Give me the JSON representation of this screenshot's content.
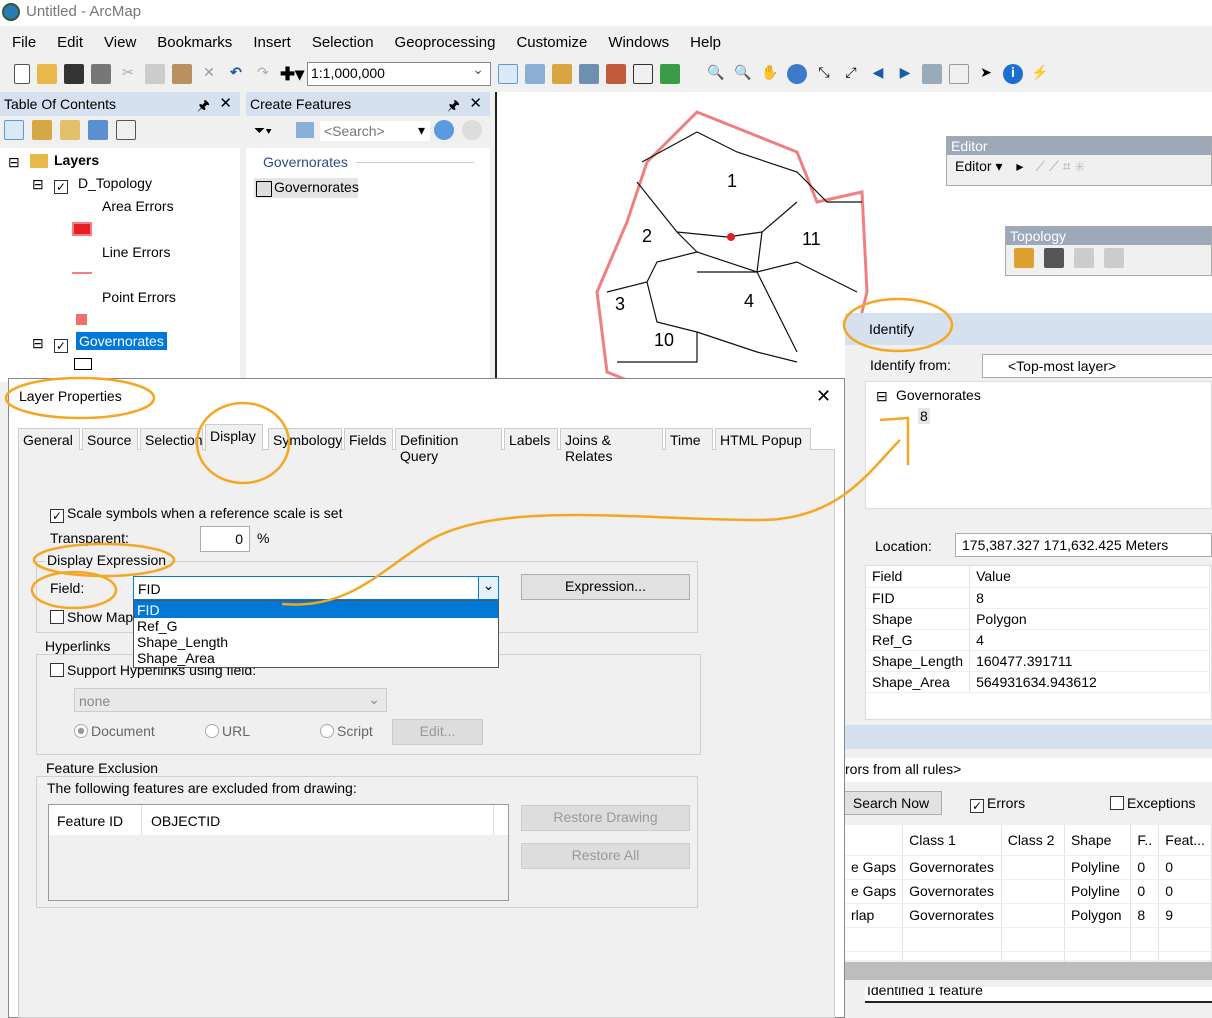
{
  "app": {
    "title": "Untitled - ArcMap"
  },
  "menu": [
    "File",
    "Edit",
    "View",
    "Bookmarks",
    "Insert",
    "Selection",
    "Geoprocessing",
    "Customize",
    "Windows",
    "Help"
  ],
  "toolbar": {
    "scale": "1:1,000,000"
  },
  "toc": {
    "title": "Table Of Contents",
    "layers_root": "Layers",
    "topology": "D_Topology",
    "area_errors": "Area Errors",
    "line_errors": "Line Errors",
    "point_errors": "Point Errors",
    "governorates": "Governorates"
  },
  "create_features": {
    "title": "Create Features",
    "search_placeholder": "<Search>",
    "group": "Governorates",
    "item": "Governorates"
  },
  "map": {
    "labels": [
      "1",
      "2",
      "11",
      "3",
      "4",
      "10"
    ],
    "error_color": "#f08080"
  },
  "editor": {
    "title": "Editor",
    "menu": "Editor ▾"
  },
  "topology": {
    "title": "Topology"
  },
  "identify": {
    "title": "Identify",
    "from_label": "Identify from:",
    "from_value": "<Top-most layer>",
    "tree_layer": "Governorates",
    "tree_item": "8",
    "location_label": "Location:",
    "location_value": "175,387.327  171,632.425 Meters",
    "headers": [
      "Field",
      "Value"
    ],
    "rows": [
      [
        "FID",
        "8"
      ],
      [
        "Shape",
        "Polygon"
      ],
      [
        "Ref_G",
        "4"
      ],
      [
        "Shape_Length",
        "160477.391711"
      ],
      [
        "Shape_Area",
        "564931634.943612"
      ]
    ],
    "status": "Identified 1 feature"
  },
  "error_inspector": {
    "show": "rors from all rules>",
    "search_now": "Search Now",
    "errors_label": "Errors",
    "errors_checked": true,
    "exceptions_label": "Exceptions",
    "exceptions_checked": false,
    "headers": [
      "",
      "Class 1",
      "Class 2",
      "Shape",
      "F..",
      "Feat..."
    ],
    "rows": [
      [
        "e Gaps",
        "Governorates",
        "",
        "Polyline",
        "0",
        "0"
      ],
      [
        "e Gaps",
        "Governorates",
        "",
        "Polyline",
        "0",
        "0"
      ],
      [
        "rlap",
        "Governorates",
        "",
        "Polygon",
        "8",
        "9"
      ]
    ]
  },
  "dialog": {
    "title": "Layer Properties",
    "tabs": [
      "General",
      "Source",
      "Selection",
      "Display",
      "Symbology",
      "Fields",
      "Definition Query",
      "Labels",
      "Joins & Relates",
      "Time",
      "HTML Popup"
    ],
    "active_tab": "Display",
    "scale_symbols": "Scale symbols when a reference scale is set",
    "transparent_label": "Transparent:",
    "transparent_value": "0",
    "percent": "%",
    "display_expression": "Display Expression",
    "field_label": "Field:",
    "field_value": "FID",
    "field_options": [
      "FID",
      "Ref_G",
      "Shape_Length",
      "Shape_Area"
    ],
    "expression_button": "Expression...",
    "show_maptips": "Show Map",
    "hyperlinks": "Hyperlinks",
    "support_hyperlinks": "Support Hyperlinks using field:",
    "hyperlink_field": "none",
    "radio_document": "Document",
    "radio_url": "URL",
    "radio_script": "Script",
    "edit_button": "Edit...",
    "feature_exclusion": "Feature Exclusion",
    "exclusion_desc": "The following features are excluded from drawing:",
    "exclusion_headers": [
      "Feature ID",
      "OBJECTID"
    ],
    "restore_drawing": "Restore Drawing",
    "restore_all": "Restore All"
  },
  "annotation_color": "#f5a623"
}
